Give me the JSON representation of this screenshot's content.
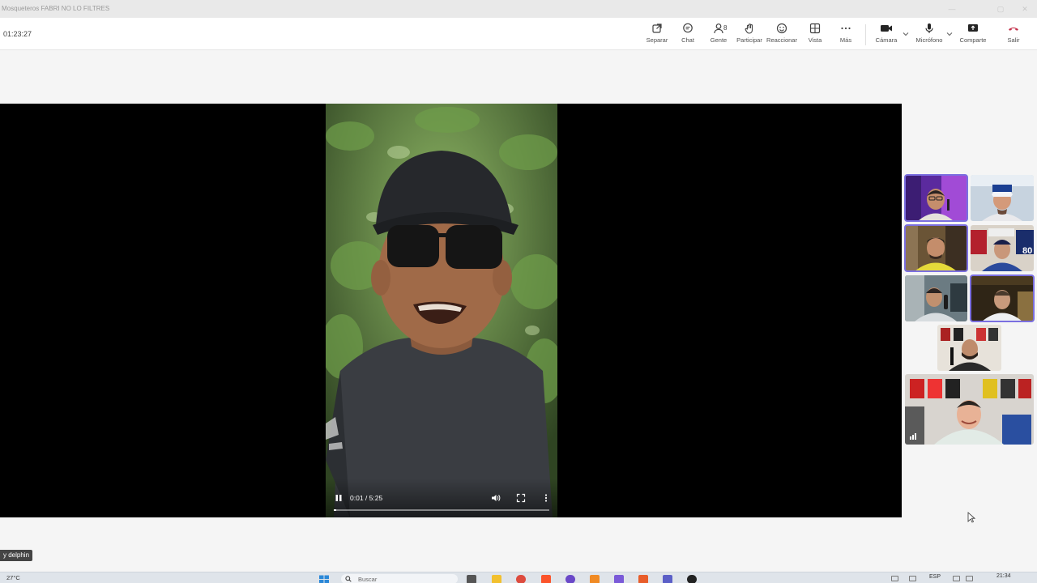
{
  "window": {
    "title": "Mosqueteros FABRI NO LO FILTRES"
  },
  "meeting": {
    "timer": "01:23:27",
    "toolbar": {
      "separar": "Separar",
      "chat": "Chat",
      "gente": "Gente",
      "people_count": "8",
      "participar": "Participar",
      "reaccionar": "Reaccionar",
      "vista": "Vista",
      "mas": "Más",
      "camara": "Cámara",
      "microfono": "Micrófono",
      "compartir": "Comparte",
      "salir": "Salir"
    }
  },
  "shared_video": {
    "time": "0:01 / 5:25",
    "progress": 0.003,
    "state": "playing"
  },
  "name_tag": "y delphin",
  "colors": {
    "accent": "#7b6fe0",
    "leave": "#c4314b",
    "stage": "#000000"
  },
  "taskbar": {
    "weather": "27°C",
    "search_placeholder": "Buscar",
    "language": "ESP",
    "clock": "21:34"
  }
}
